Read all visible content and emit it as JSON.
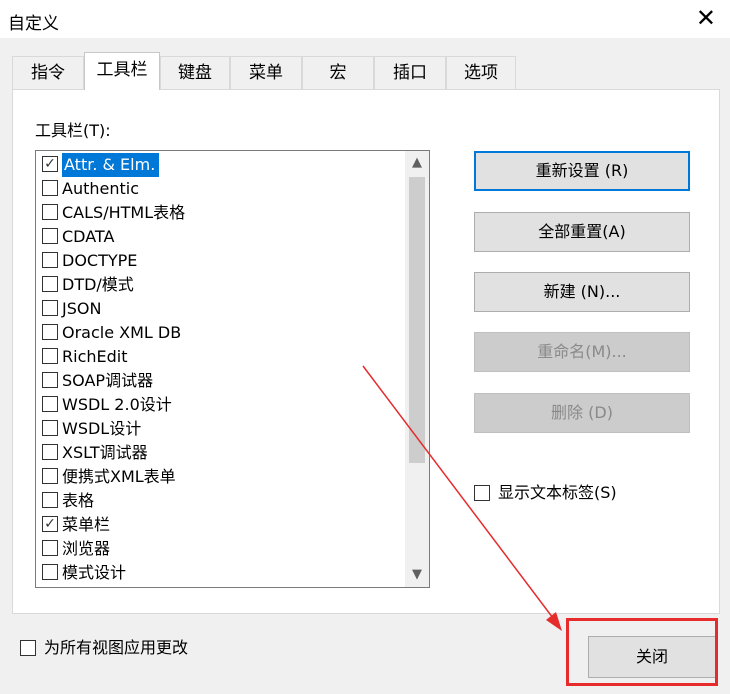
{
  "window": {
    "title": "自定义",
    "close_glyph": "✕"
  },
  "tabs": [
    {
      "label": "指令"
    },
    {
      "label": "工具栏"
    },
    {
      "label": "键盘"
    },
    {
      "label": "菜单"
    },
    {
      "label": "宏"
    },
    {
      "label": "插口"
    },
    {
      "label": "选项"
    }
  ],
  "toolbar_list": {
    "label": "工具栏(T):",
    "items": [
      {
        "label": "Attr. & Elm.",
        "checked": true,
        "selected": true
      },
      {
        "label": "Authentic",
        "checked": false
      },
      {
        "label": "CALS/HTML表格",
        "checked": false
      },
      {
        "label": "CDATA",
        "checked": false
      },
      {
        "label": "DOCTYPE",
        "checked": false
      },
      {
        "label": "DTD/模式",
        "checked": false
      },
      {
        "label": "JSON",
        "checked": false
      },
      {
        "label": "Oracle XML DB",
        "checked": false
      },
      {
        "label": "RichEdit",
        "checked": false
      },
      {
        "label": "SOAP调试器",
        "checked": false
      },
      {
        "label": "WSDL 2.0设计",
        "checked": false
      },
      {
        "label": "WSDL设计",
        "checked": false
      },
      {
        "label": "XSLT调试器",
        "checked": false
      },
      {
        "label": "便携式XML表单",
        "checked": false
      },
      {
        "label": "表格",
        "checked": false
      },
      {
        "label": "菜单栏",
        "checked": true
      },
      {
        "label": "浏览器",
        "checked": false
      },
      {
        "label": "模式设计",
        "checked": false
      }
    ]
  },
  "buttons": {
    "reset": "重新设置 (R)",
    "reset_all": "全部重置(A)",
    "new": "新建 (N)...",
    "rename": "重命名(M)...",
    "delete": "删除 (D)"
  },
  "show_text_labels": {
    "label": "显示文本标签(S)",
    "checked": false
  },
  "apply_all_views": {
    "label": "为所有视图应用更改",
    "checked": false
  },
  "close_button": "关闭",
  "colors": {
    "accent": "#0078d7",
    "annotation_red": "#e52b2b"
  }
}
